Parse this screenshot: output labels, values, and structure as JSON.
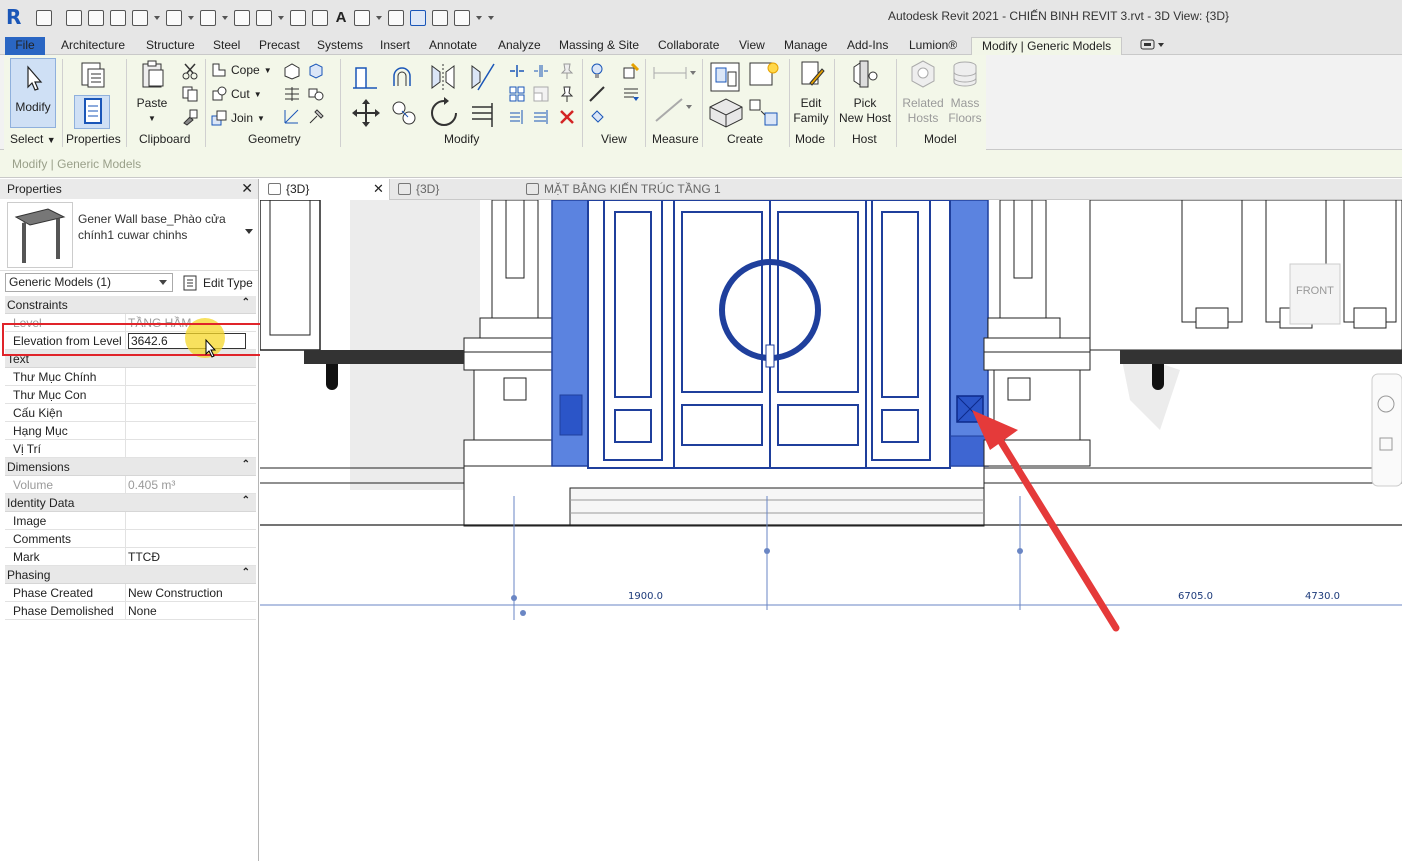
{
  "app": {
    "logo": "R",
    "title": "Autodesk Revit 2021 - CHIẾN BINH REVIT 3.rvt - 3D View: {3D}"
  },
  "tabs": [
    "File",
    "Architecture",
    "Structure",
    "Steel",
    "Precast",
    "Systems",
    "Insert",
    "Annotate",
    "Analyze",
    "Massing & Site",
    "Collaborate",
    "View",
    "Manage",
    "Add-Ins",
    "Lumion®",
    "Modify | Generic Models"
  ],
  "ribbon": {
    "modify_label": "Modify",
    "paste_label": "Paste",
    "cope_label": "Cope",
    "cut_label": "Cut",
    "join_label": "Join",
    "edit_family_label": "Edit\nFamily",
    "pick_new_host_label": "Pick\nNew Host",
    "related_hosts_label": "Related\nHosts",
    "mass_floors_label": "Mass\nFloors",
    "panels": {
      "select": "Select",
      "properties": "Properties",
      "clipboard": "Clipboard",
      "geometry": "Geometry",
      "modify": "Modify",
      "view": "View",
      "measure": "Measure",
      "create": "Create",
      "mode": "Mode",
      "host": "Host",
      "model": "Model"
    }
  },
  "options_bar": {
    "label": "Modify | Generic Models"
  },
  "properties": {
    "header": "Properties",
    "type_name": "Gener Wall base_Phào cửa chính1 cuwar chinhs",
    "filter": "Generic Models (1)",
    "edit_type": "Edit Type",
    "groups": {
      "constraints": "Constraints",
      "text": "Text",
      "dimensions": "Dimensions",
      "identity": "Identity Data",
      "phasing": "Phasing"
    },
    "rows": {
      "level_k": "Level",
      "level_v": "TẦNG HẦM",
      "elev_k": "Elevation from Level",
      "elev_v": "3642.6",
      "thu_muc_chinh": "Thư Mục Chính",
      "thu_muc_con": "Thư Mục Con",
      "cau_kien": "Cấu Kiện",
      "hang_muc": "Hạng Mục",
      "vi_tri": "Vị Trí",
      "volume_k": "Volume",
      "volume_v": "0.405 m³",
      "image_k": "Image",
      "comments_k": "Comments",
      "mark_k": "Mark",
      "mark_v": "TTCĐ",
      "phase_created_k": "Phase Created",
      "phase_created_v": "New Construction",
      "phase_demolished_k": "Phase Demolished",
      "phase_demolished_v": "None"
    }
  },
  "view_tabs": [
    "{3D}",
    "{3D}",
    "MẶT BẰNG KIẾN TRÚC TẦNG 1"
  ],
  "viewcube_label": "FRONT",
  "dimensions": [
    "1900.0",
    "6705.0",
    "4730.0"
  ],
  "colors": {
    "accent": "#2a66c3",
    "selection": "#2b55c8",
    "arrow": "#e53a3a",
    "highlight": "#e0242a"
  }
}
